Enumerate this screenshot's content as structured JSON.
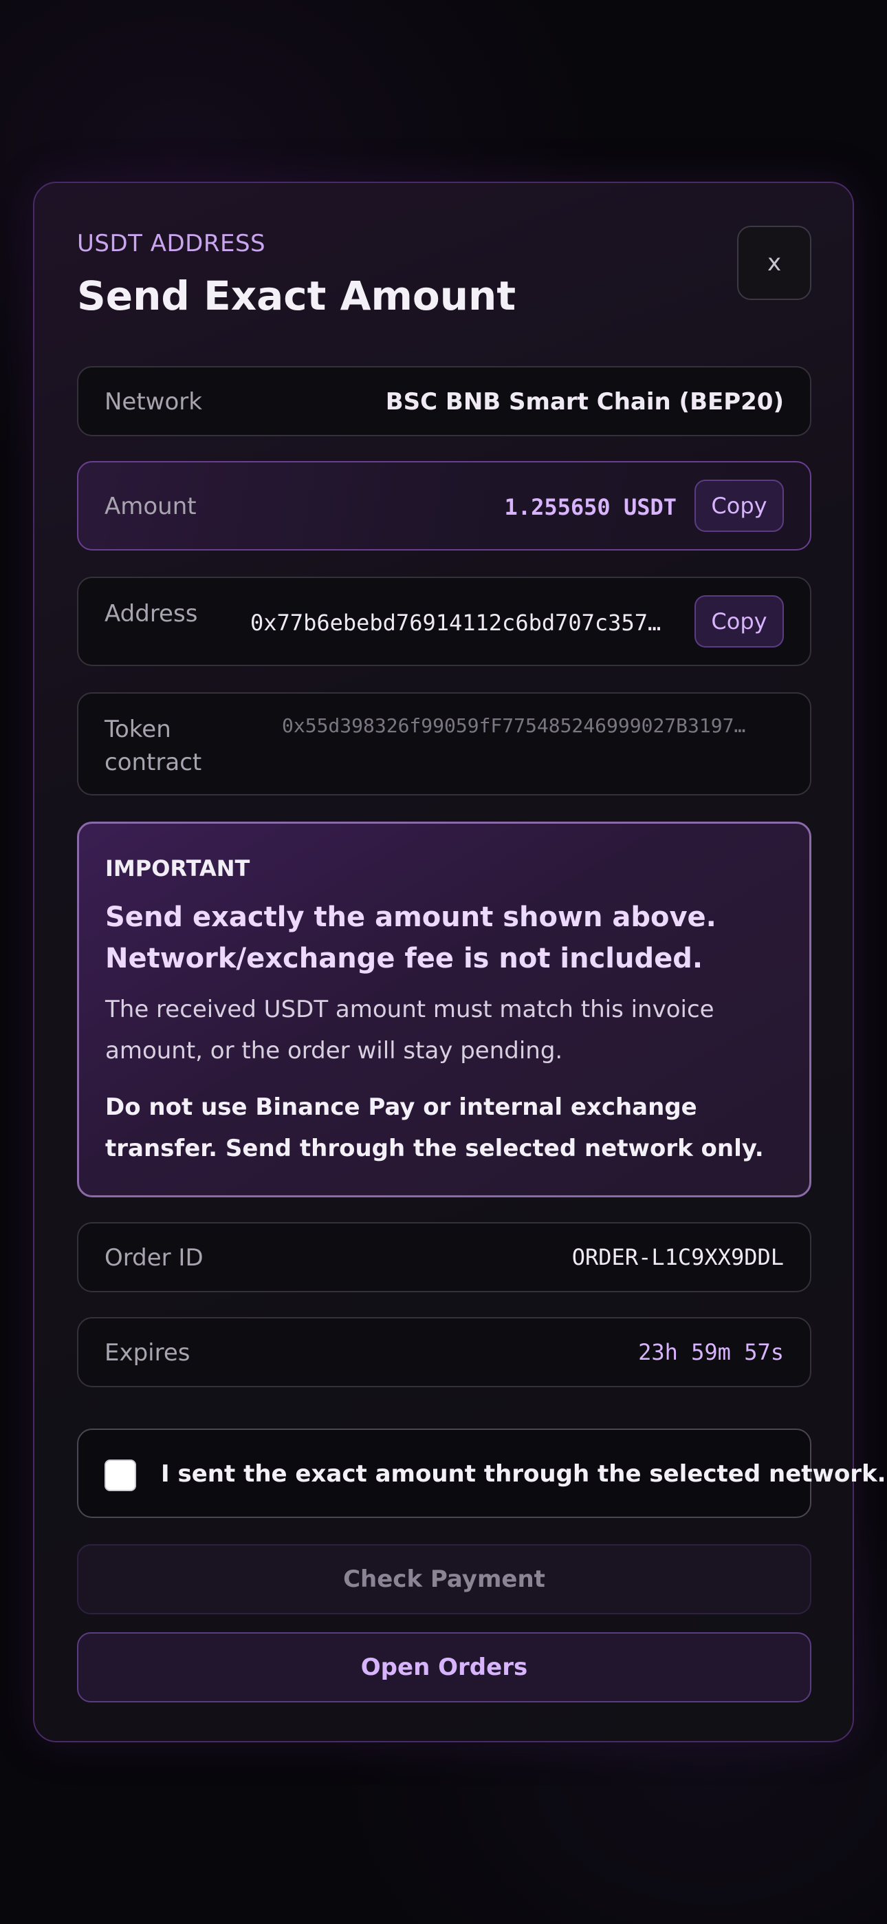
{
  "header": {
    "kicker": "USDT ADDRESS",
    "title": "Send Exact Amount",
    "close_label": "x"
  },
  "rows": {
    "network": {
      "label": "Network",
      "value": "BSC BNB Smart Chain (BEP20)"
    },
    "amount": {
      "label": "Amount",
      "value": "1.255650 USDT",
      "copy_label": "Copy"
    },
    "address": {
      "label": "Address",
      "value": "0x77b6ebebd76914112c6bd707c357…",
      "copy_label": "Copy"
    },
    "token": {
      "label": "Token contract",
      "value": "0x55d398326f99059fF775485246999027B3197…"
    },
    "order": {
      "label": "Order ID",
      "value": "ORDER-L1C9XX9DDL"
    },
    "expires": {
      "label": "Expires",
      "value": "23h 59m 57s"
    }
  },
  "important": {
    "tag": "IMPORTANT",
    "headline": "Send exactly the amount shown above. Network/exchange fee is not included.",
    "body": "The received USDT amount must match this invoice amount, or the order will stay pending.",
    "warning": "Do not use Binance Pay or internal exchange transfer. Send through the selected network only."
  },
  "confirm": {
    "label": "I sent the exact amount through the selected network.",
    "checked": false
  },
  "buttons": {
    "check_payment": "Check Payment",
    "open_orders": "Open Orders"
  },
  "colors": {
    "accent": "#d7b4fb",
    "background": "#08070b",
    "border_accent": "#5b3c82"
  }
}
